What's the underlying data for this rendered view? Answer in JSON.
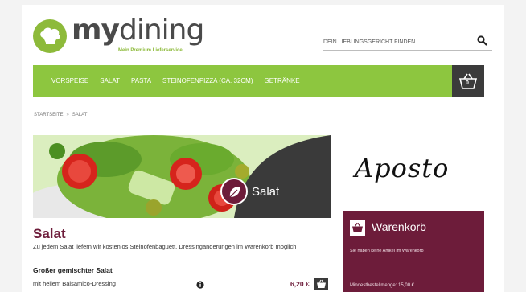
{
  "header": {
    "logo_brand": "my",
    "logo_brand_bold": "dining",
    "logo_tagline": "Mein Premium Lieferservice",
    "search_placeholder": "DEIN LIEBLINGSGERICHT FINDEN"
  },
  "nav": {
    "items": [
      {
        "label": "Vorspeise"
      },
      {
        "label": "Salat"
      },
      {
        "label": "Pasta"
      },
      {
        "label": "Steinofenpizza (ca. 32cm)"
      },
      {
        "label": "Getränke"
      }
    ],
    "cart_count": "0"
  },
  "breadcrumb": {
    "home": "Startseite",
    "separator": "»",
    "current": "Salat"
  },
  "banner": {
    "label": "Salat"
  },
  "category": {
    "title": "Salat",
    "description": "Zu jedem Salat liefern wir kostenlos Steinofenbaguett, Dressingänderungen im Warenkorb möglich"
  },
  "product": {
    "name": "Großer gemischter Salat",
    "variant": "mit hellem Balsamico-Dressing",
    "price": "6,20 €"
  },
  "restaurant": {
    "name": "Aposto"
  },
  "basket": {
    "title": "Warenkorb",
    "empty_text": "Sie haben keine Artikel im Warenkorb",
    "min_order": "Mindestbestellmenge: 15,00 €"
  },
  "colors": {
    "brand_green": "#8dc63f",
    "accent_burgundy": "#6d1c3a",
    "dark_gray": "#3a3a3a"
  },
  "icons": {
    "search": "search-icon",
    "cart": "basket-icon",
    "info": "info-icon",
    "salad": "leaf-icon"
  }
}
